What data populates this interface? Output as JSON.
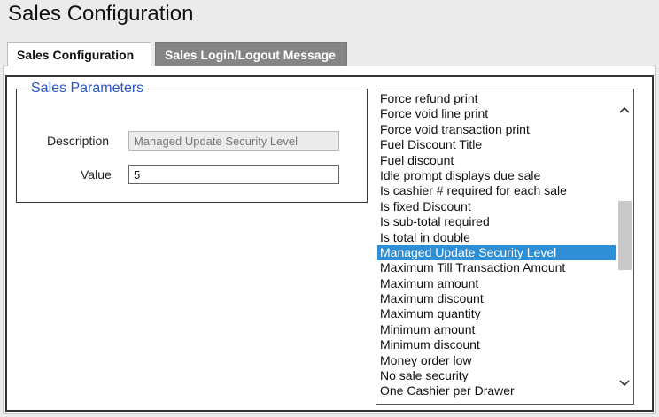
{
  "page": {
    "title": "Sales Configuration"
  },
  "tabs": [
    {
      "label": "Sales Configuration",
      "active": true
    },
    {
      "label": "Sales Login/Logout Message",
      "active": false
    }
  ],
  "parameters": {
    "group_title": "Sales Parameters",
    "description_label": "Description",
    "description_value": "Managed Update Security Level",
    "value_label": "Value",
    "value_value": "5"
  },
  "list": {
    "selected_index": 11,
    "items": [
      "Force refund print",
      "Force void line print",
      "Force void transaction print",
      "Fuel Discount Title",
      "Fuel discount",
      "Idle prompt displays due sale",
      "Is cashier # required for each sale",
      "Is fixed Discount",
      "Is sub-total required",
      "Is total in double",
      "Managed Update Security Level",
      "Maximum Till Transaction Amount",
      "Maximum amount",
      "Maximum discount",
      "Maximum quantity",
      "Minimum amount",
      "Minimum discount",
      "Money order low",
      "No sale security",
      "One Cashier per Drawer"
    ]
  },
  "colors": {
    "legend": "#2a55c8",
    "selection": "#2e8fd7",
    "inactive_tab": "#858585"
  },
  "icons": {
    "scroll_up": "chevron-up-icon",
    "scroll_down": "chevron-down-icon"
  }
}
